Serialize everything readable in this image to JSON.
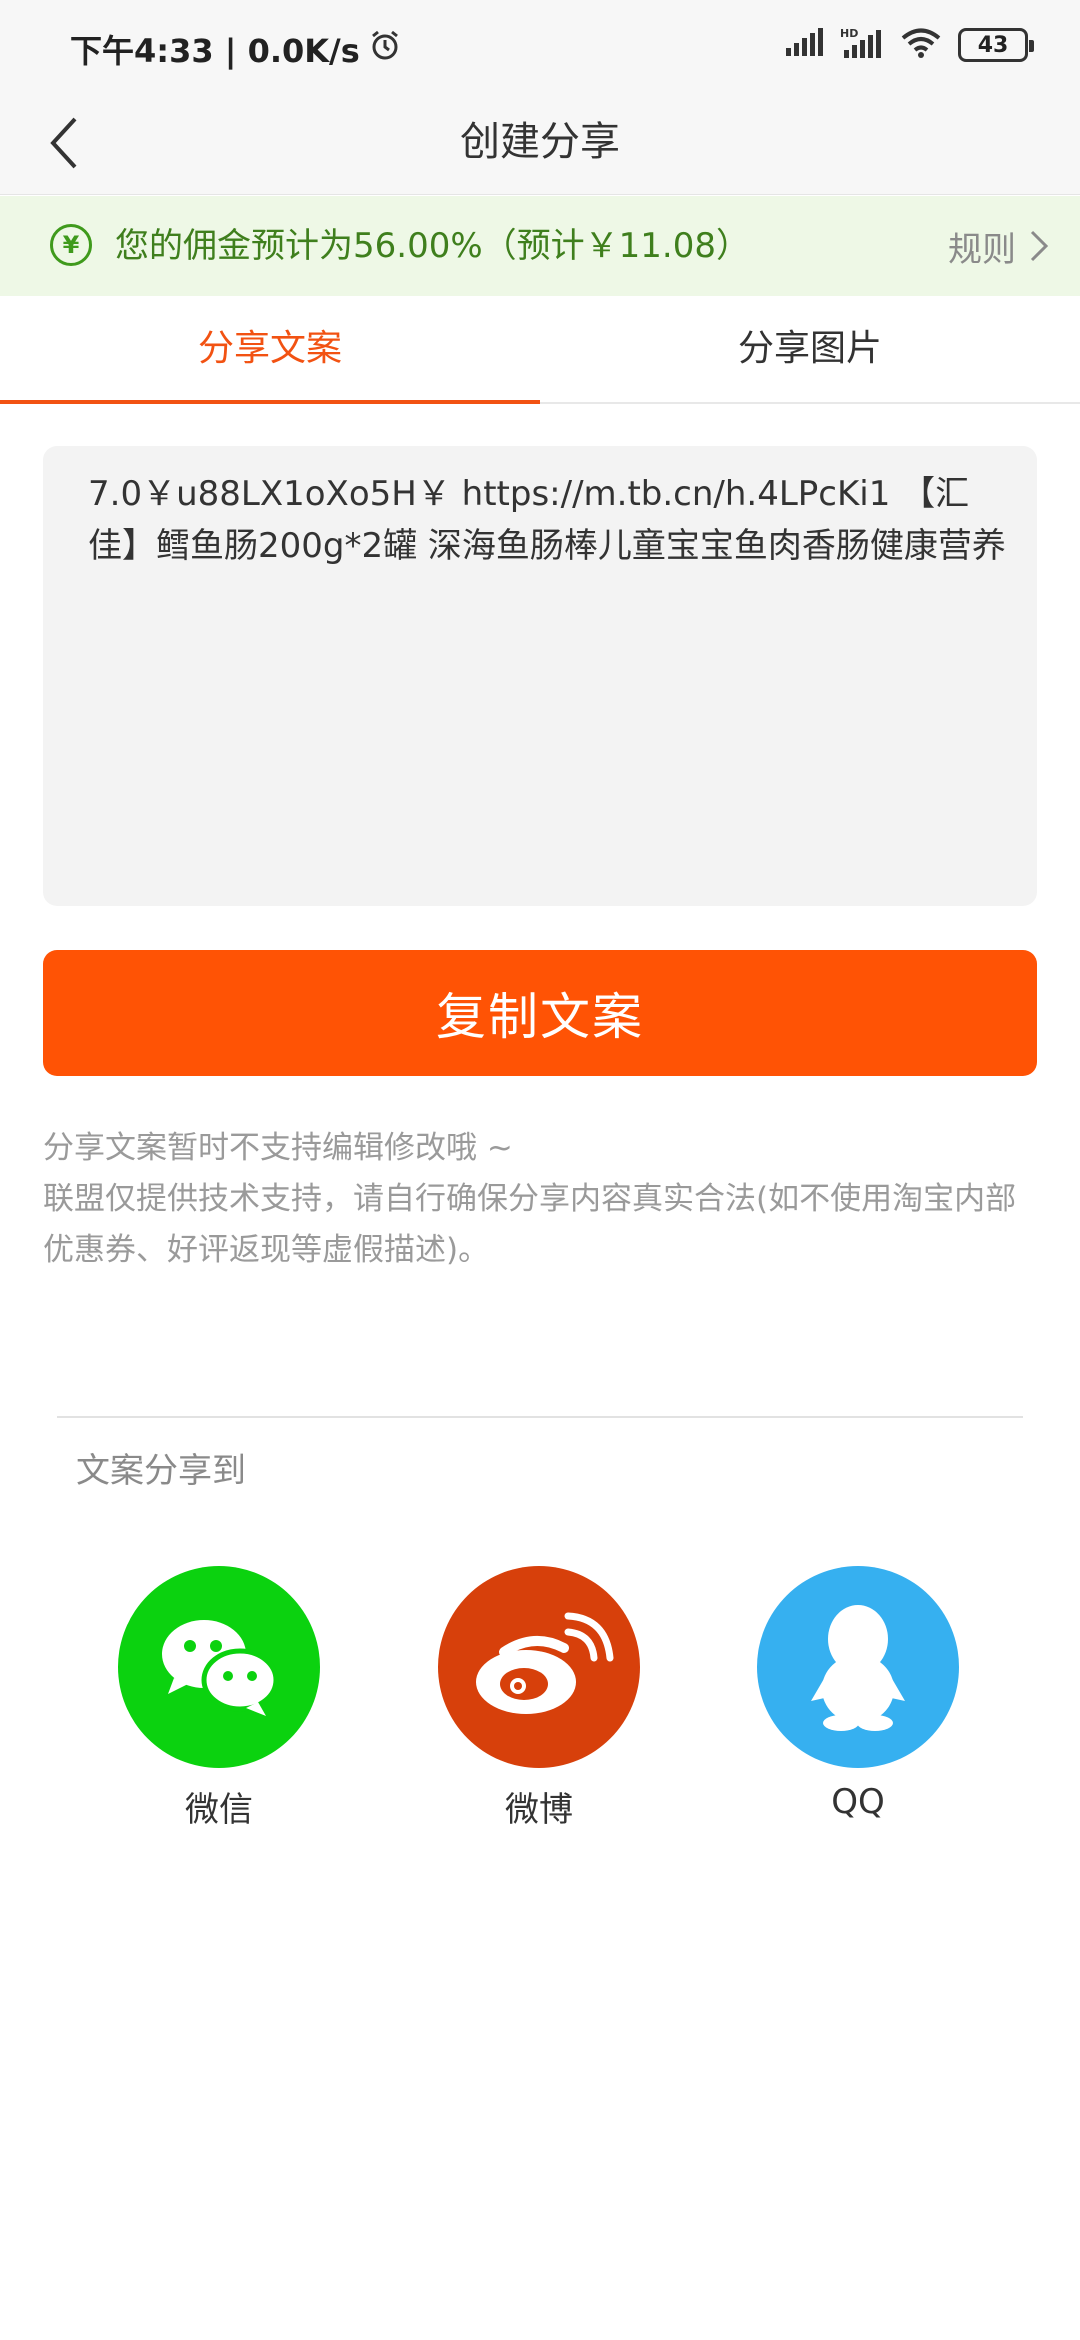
{
  "status_bar": {
    "time_speed": "下午4:33 | 0.0K/s",
    "battery": "43"
  },
  "nav": {
    "title": "创建分享"
  },
  "commission": {
    "text": "您的佣金预计为56.00%（预计￥11.08）",
    "rules_label": "规则",
    "icon_glyph": "¥"
  },
  "tabs": [
    {
      "label": "分享文案",
      "active": true
    },
    {
      "label": "分享图片",
      "active": false
    }
  ],
  "share_text": "7.0￥u88LX1oXo5H￥ https://m.tb.cn/h.4LPcKi1 【汇佳】鳕鱼肠200g*2罐 深海鱼肠棒儿童宝宝鱼肉香肠健康营养",
  "copy_button": "复制文案",
  "notes": [
    "分享文案暂时不支持编辑修改哦 ~",
    "联盟仅提供技术支持，请自行确保分享内容真实合法(如不使用淘宝内部优惠券、好评返现等虚假描述)。"
  ],
  "share_section": {
    "title": "文案分享到",
    "targets": [
      {
        "name": "微信",
        "icon": "wechat-icon",
        "color": "#0bd20f"
      },
      {
        "name": "微博",
        "icon": "weibo-icon",
        "color": "#d7400b"
      },
      {
        "name": "QQ",
        "icon": "qq-icon",
        "color": "#36b0f0"
      }
    ]
  },
  "colors": {
    "accent": "#ff5305",
    "tab_active": "#f25212",
    "commission_bg": "#eef8e6",
    "commission_text": "#3f7f1d"
  }
}
